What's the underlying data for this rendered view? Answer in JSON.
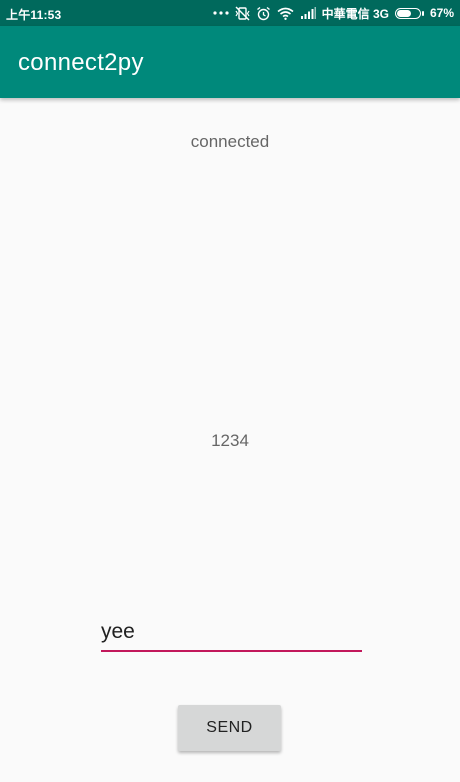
{
  "status_bar": {
    "time": "上午11:53",
    "carrier": "中華電信 3G",
    "battery_percent": "67%",
    "battery_level": 0.67,
    "icons": [
      "more-dots-icon",
      "vibrate-off-icon",
      "alarm-icon",
      "wifi-icon",
      "signal-icon",
      "battery-icon"
    ]
  },
  "app_bar": {
    "title": "connect2py",
    "color": "#00897b"
  },
  "main": {
    "connection_status": "connected",
    "received_message": "1234",
    "message_input": {
      "value": "yee",
      "accent_color": "#c2185b"
    },
    "send_button_label": "SEND"
  }
}
